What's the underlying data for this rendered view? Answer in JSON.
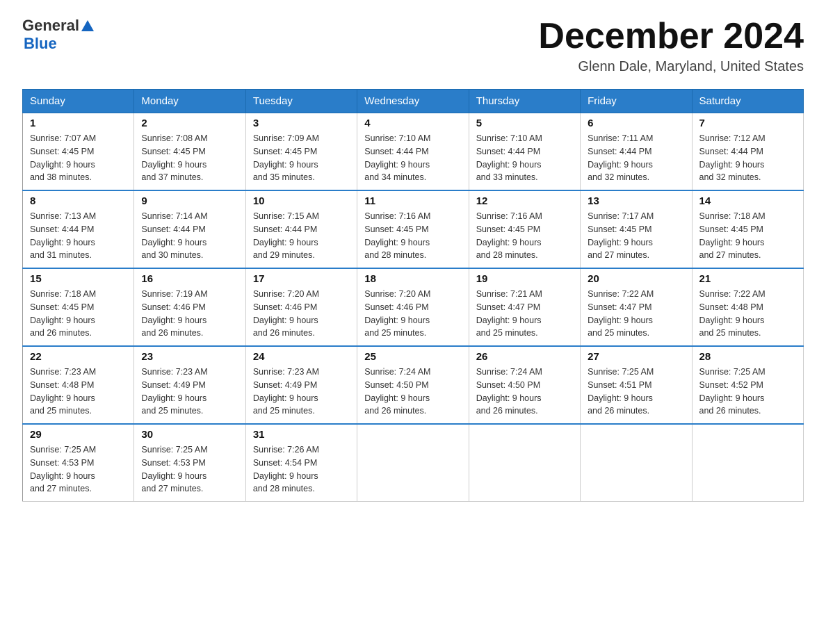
{
  "header": {
    "logo": {
      "general": "General",
      "blue": "Blue",
      "triangle_color": "#1565c0"
    },
    "title": "December 2024",
    "location": "Glenn Dale, Maryland, United States"
  },
  "calendar": {
    "weekdays": [
      "Sunday",
      "Monday",
      "Tuesday",
      "Wednesday",
      "Thursday",
      "Friday",
      "Saturday"
    ],
    "weeks": [
      [
        {
          "day": "1",
          "sunrise": "7:07 AM",
          "sunset": "4:45 PM",
          "daylight": "9 hours and 38 minutes."
        },
        {
          "day": "2",
          "sunrise": "7:08 AM",
          "sunset": "4:45 PM",
          "daylight": "9 hours and 37 minutes."
        },
        {
          "day": "3",
          "sunrise": "7:09 AM",
          "sunset": "4:45 PM",
          "daylight": "9 hours and 35 minutes."
        },
        {
          "day": "4",
          "sunrise": "7:10 AM",
          "sunset": "4:44 PM",
          "daylight": "9 hours and 34 minutes."
        },
        {
          "day": "5",
          "sunrise": "7:10 AM",
          "sunset": "4:44 PM",
          "daylight": "9 hours and 33 minutes."
        },
        {
          "day": "6",
          "sunrise": "7:11 AM",
          "sunset": "4:44 PM",
          "daylight": "9 hours and 32 minutes."
        },
        {
          "day": "7",
          "sunrise": "7:12 AM",
          "sunset": "4:44 PM",
          "daylight": "9 hours and 32 minutes."
        }
      ],
      [
        {
          "day": "8",
          "sunrise": "7:13 AM",
          "sunset": "4:44 PM",
          "daylight": "9 hours and 31 minutes."
        },
        {
          "day": "9",
          "sunrise": "7:14 AM",
          "sunset": "4:44 PM",
          "daylight": "9 hours and 30 minutes."
        },
        {
          "day": "10",
          "sunrise": "7:15 AM",
          "sunset": "4:44 PM",
          "daylight": "9 hours and 29 minutes."
        },
        {
          "day": "11",
          "sunrise": "7:16 AM",
          "sunset": "4:45 PM",
          "daylight": "9 hours and 28 minutes."
        },
        {
          "day": "12",
          "sunrise": "7:16 AM",
          "sunset": "4:45 PM",
          "daylight": "9 hours and 28 minutes."
        },
        {
          "day": "13",
          "sunrise": "7:17 AM",
          "sunset": "4:45 PM",
          "daylight": "9 hours and 27 minutes."
        },
        {
          "day": "14",
          "sunrise": "7:18 AM",
          "sunset": "4:45 PM",
          "daylight": "9 hours and 27 minutes."
        }
      ],
      [
        {
          "day": "15",
          "sunrise": "7:18 AM",
          "sunset": "4:45 PM",
          "daylight": "9 hours and 26 minutes."
        },
        {
          "day": "16",
          "sunrise": "7:19 AM",
          "sunset": "4:46 PM",
          "daylight": "9 hours and 26 minutes."
        },
        {
          "day": "17",
          "sunrise": "7:20 AM",
          "sunset": "4:46 PM",
          "daylight": "9 hours and 26 minutes."
        },
        {
          "day": "18",
          "sunrise": "7:20 AM",
          "sunset": "4:46 PM",
          "daylight": "9 hours and 25 minutes."
        },
        {
          "day": "19",
          "sunrise": "7:21 AM",
          "sunset": "4:47 PM",
          "daylight": "9 hours and 25 minutes."
        },
        {
          "day": "20",
          "sunrise": "7:22 AM",
          "sunset": "4:47 PM",
          "daylight": "9 hours and 25 minutes."
        },
        {
          "day": "21",
          "sunrise": "7:22 AM",
          "sunset": "4:48 PM",
          "daylight": "9 hours and 25 minutes."
        }
      ],
      [
        {
          "day": "22",
          "sunrise": "7:23 AM",
          "sunset": "4:48 PM",
          "daylight": "9 hours and 25 minutes."
        },
        {
          "day": "23",
          "sunrise": "7:23 AM",
          "sunset": "4:49 PM",
          "daylight": "9 hours and 25 minutes."
        },
        {
          "day": "24",
          "sunrise": "7:23 AM",
          "sunset": "4:49 PM",
          "daylight": "9 hours and 25 minutes."
        },
        {
          "day": "25",
          "sunrise": "7:24 AM",
          "sunset": "4:50 PM",
          "daylight": "9 hours and 26 minutes."
        },
        {
          "day": "26",
          "sunrise": "7:24 AM",
          "sunset": "4:50 PM",
          "daylight": "9 hours and 26 minutes."
        },
        {
          "day": "27",
          "sunrise": "7:25 AM",
          "sunset": "4:51 PM",
          "daylight": "9 hours and 26 minutes."
        },
        {
          "day": "28",
          "sunrise": "7:25 AM",
          "sunset": "4:52 PM",
          "daylight": "9 hours and 26 minutes."
        }
      ],
      [
        {
          "day": "29",
          "sunrise": "7:25 AM",
          "sunset": "4:53 PM",
          "daylight": "9 hours and 27 minutes."
        },
        {
          "day": "30",
          "sunrise": "7:25 AM",
          "sunset": "4:53 PM",
          "daylight": "9 hours and 27 minutes."
        },
        {
          "day": "31",
          "sunrise": "7:26 AM",
          "sunset": "4:54 PM",
          "daylight": "9 hours and 28 minutes."
        },
        null,
        null,
        null,
        null
      ]
    ]
  }
}
